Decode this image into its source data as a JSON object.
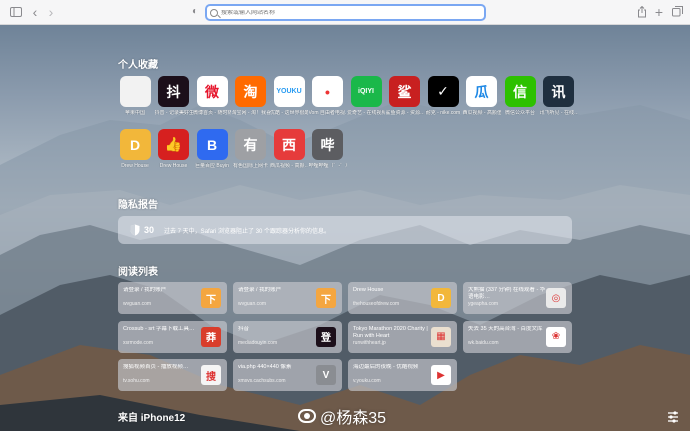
{
  "toolbar": {
    "sidebar_icon": "sidebar-icon",
    "back_icon": "‹",
    "forward_icon": "›",
    "privacy_icon": "◐",
    "address_placeholder": "搜索或输入网站名称",
    "share_icon": "share-icon",
    "new_tab_icon": "+",
    "tabs_icon": "tabs-icon"
  },
  "favorites": {
    "title": "个人收藏",
    "items": [
      {
        "label": "苹果中国",
        "glyph": "",
        "bg": "#f2f2f2",
        "fg": "#555"
      },
      {
        "label": "抖音 - 记录美好生活",
        "glyph": "抖",
        "bg": "#1c0f1a",
        "fg": "#fff"
      },
      {
        "label": "微博首页 - 随时随地…",
        "glyph": "微",
        "bg": "#ffffff",
        "fg": "#e6162d"
      },
      {
        "label": "淘宝网 - 淘！我喜欢",
        "glyph": "淘",
        "bg": "#ff6a00",
        "fg": "#fff"
      },
      {
        "label": "优酷 - 这世界很酷",
        "glyph": "YOUKU",
        "bg": "#ffffff",
        "fg": "#2a9cf2"
      },
      {
        "label": "Vom 自由者电视…",
        "glyph": "•",
        "bg": "#ffffff",
        "fg": "#e33"
      },
      {
        "label": "爱奇艺 - 在线视频…",
        "glyph": "iQIYI",
        "bg": "#1ab84a",
        "fg": "#fff"
      },
      {
        "label": "鲨鱼资源 - 资源…",
        "glyph": "鲨",
        "bg": "#c82020",
        "fg": "#fff"
      },
      {
        "label": "耐克 - nike.com",
        "glyph": "✓",
        "bg": "#000000",
        "fg": "#fff"
      },
      {
        "label": "西瓜视频 - 高颜值…",
        "glyph": "瓜",
        "bg": "#ffffff",
        "fg": "#1e88e5"
      },
      {
        "label": "微信公众平台",
        "glyph": "信",
        "bg": "#2dc100",
        "fg": "#fff"
      },
      {
        "label": "讯飞听见 - 在线…",
        "glyph": "讯",
        "bg": "#1f2f3f",
        "fg": "#fff"
      },
      {
        "label": "Drew House",
        "glyph": "D",
        "bg": "#f2b73a",
        "fg": "#fff"
      },
      {
        "label": "Drew House",
        "glyph": "👍",
        "bg": "#d6201f",
        "fg": "#fff"
      },
      {
        "label": "巨量百应 Buyin",
        "glyph": "B",
        "bg": "#2f6af0",
        "fg": "#fff"
      },
      {
        "label": "有色国际上网卡",
        "glyph": "有",
        "bg": "#9ea0a4",
        "fg": "#fff"
      },
      {
        "label": "西瓜视频 - 高颜…",
        "glyph": "西",
        "bg": "#e63b3b",
        "fg": "#fff"
      },
      {
        "label": "哔哩哔哩（゜-゜）…",
        "glyph": "哔",
        "bg": "#5c5d61",
        "fg": "#fff"
      }
    ]
  },
  "privacy": {
    "title": "隐私报告",
    "count": "30",
    "text": "过去 7 天中，Safari 浏览器阻止了 30 个跟踪器分析你的信息。"
  },
  "reading": {
    "title": "阅读列表",
    "items": [
      {
        "title": "请登录 / 我的账户",
        "url": "wvguan.com",
        "thumb": "下",
        "bg": "#f4a640"
      },
      {
        "title": "请登录 / 我的账户",
        "url": "wvguan.com",
        "thumb": "下",
        "bg": "#f4a640"
      },
      {
        "title": "Drew House",
        "url": "thehouseofdrew.com",
        "thumb": "D",
        "bg": "#f2b73a"
      },
      {
        "title": "大熊猫 (337 分钟) 在线观看 - 华语电影…",
        "url": "ygeapha.com",
        "thumb": "◎",
        "bg": "#eaeaea"
      },
      {
        "title": "Crossub - srt 字幕下载工具…",
        "url": "xsrmode.com",
        "thumb": "莽",
        "bg": "#d93d2b"
      },
      {
        "title": "抖音",
        "url": "mediadouyin.com",
        "thumb": "登",
        "bg": "#1c0f1a"
      },
      {
        "title": "Tokyo Marathon 2020 Charity | Run with Heart",
        "url": "runwithheart.jp",
        "thumb": "▦",
        "bg": "#eadfcf"
      },
      {
        "title": "失去 35 天的高台湾 - 百度文库",
        "url": "wk.baidu.com",
        "thumb": "❀",
        "bg": "#ffffff"
      },
      {
        "title": "搜狐视频首页 - 播放视频…",
        "url": "tv.sohu.com",
        "thumb": "搜",
        "bg": "#f5f5f5"
      },
      {
        "title": "via.php 440×440 像素",
        "url": "xmsvs.cachsubs.com",
        "thumb": "V",
        "bg": "#8a8d92"
      },
      {
        "title": "海边最后的夜晚 - 优酷视频",
        "url": "v.youku.com",
        "thumb": "▶",
        "bg": "#ffffff"
      }
    ]
  },
  "iphone": {
    "title": "来自 iPhone12"
  },
  "watermark": "@杨森35",
  "colors": {
    "accent": "#7aa7f2",
    "toolbar_bg": "#f6f6f7"
  }
}
